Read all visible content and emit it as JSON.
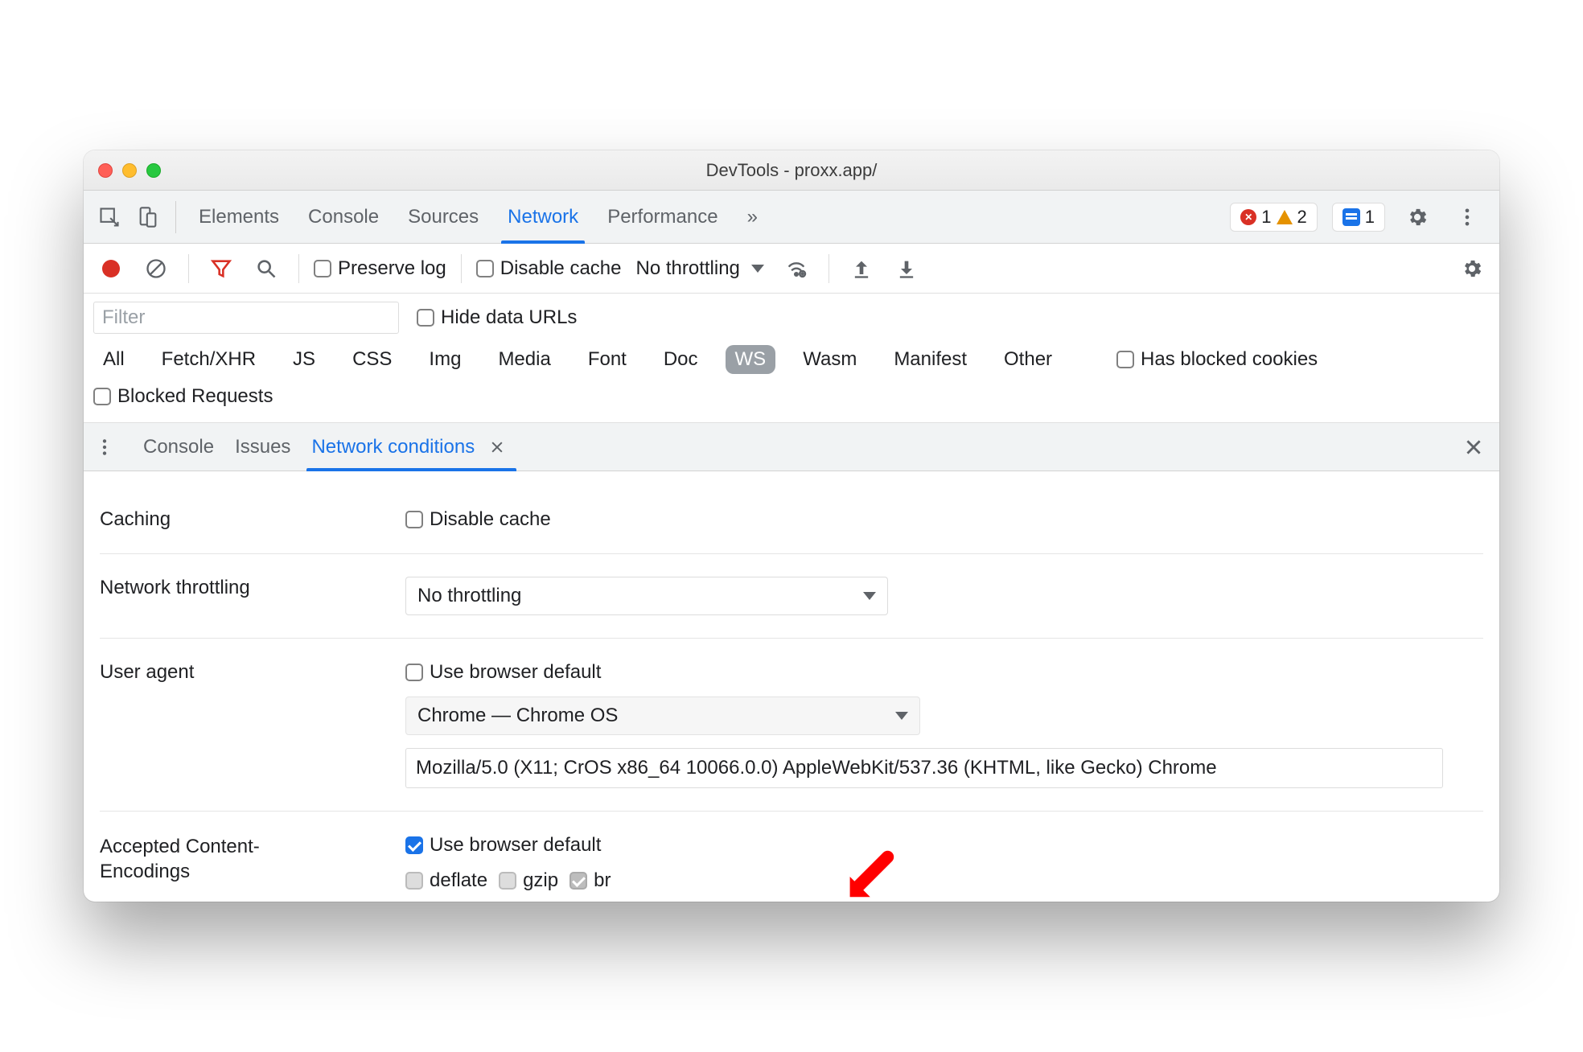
{
  "window": {
    "title": "DevTools - proxx.app/"
  },
  "tabsbar": {
    "tabs": [
      "Elements",
      "Console",
      "Sources",
      "Network",
      "Performance"
    ],
    "active": "Network",
    "more_label": "»",
    "badges": {
      "errors": "1",
      "warnings": "2",
      "messages": "1"
    }
  },
  "net_toolbar": {
    "preserve_log": "Preserve log",
    "disable_cache": "Disable cache",
    "throttling": "No throttling"
  },
  "filter": {
    "placeholder": "Filter",
    "hide_data_urls": "Hide data URLs",
    "types": [
      "All",
      "Fetch/XHR",
      "JS",
      "CSS",
      "Img",
      "Media",
      "Font",
      "Doc",
      "WS",
      "Wasm",
      "Manifest",
      "Other"
    ],
    "active_type": "WS",
    "has_blocked_cookies": "Has blocked cookies",
    "blocked_requests": "Blocked Requests"
  },
  "drawer": {
    "tabs": [
      "Console",
      "Issues",
      "Network conditions"
    ],
    "active": "Network conditions"
  },
  "conditions": {
    "caching_label": "Caching",
    "caching_checkbox": "Disable cache",
    "throttling_label": "Network throttling",
    "throttling_value": "No throttling",
    "ua_label": "User agent",
    "ua_default": "Use browser default",
    "ua_select": "Chrome — Chrome OS",
    "ua_string": "Mozilla/5.0 (X11; CrOS x86_64 10066.0.0) AppleWebKit/537.36 (KHTML, like Gecko) Chrome",
    "encodings_label_line1": "Accepted Content-",
    "encodings_label_line2": "Encodings",
    "encodings_default": "Use browser default",
    "enc_deflate": "deflate",
    "enc_gzip": "gzip",
    "enc_br": "br"
  }
}
